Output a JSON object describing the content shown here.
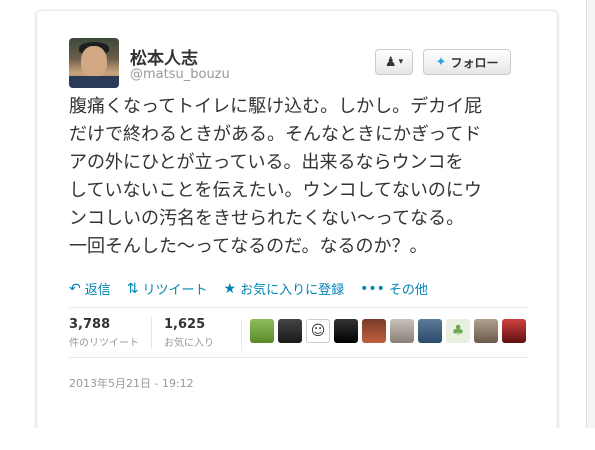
{
  "profile": {
    "name": "松本人志",
    "handle": "@matsu_bouzu"
  },
  "buttons": {
    "user_menu_label": "▾",
    "follow_label": "フォロー"
  },
  "tweet_lines": [
    "腹痛くなってトイレに駆け込む。しかし。デカイ屁",
    "だけで終わるときがある。そんなときにかぎってド",
    "アの外にひとが立っている。出来るならウンコを",
    "していないことを伝えたい。ウンコしてないのにウ",
    "ンコしいの汚名をきせられたくない〜ってなる。",
    "一回そんした〜ってなるのだ。なるのか？。"
  ],
  "actions": {
    "reply": "返信",
    "retweet": "リツイート",
    "favorite": "お気に入りに登録",
    "more": "その他"
  },
  "stats": {
    "retweets_count": "3,788",
    "retweets_label": "件のリツイート",
    "favorites_count": "1,625",
    "favorites_label": "お気に入り"
  },
  "timestamp": "2013年5月21日 - 19:12",
  "colors": {
    "link": "#0084b4",
    "bird": "#2ba3e3"
  },
  "favoriters_icons": [
    "avatar-landscape-icon",
    "avatar-person-icon",
    "avatar-face-cartoon-icon",
    "avatar-dark-figure-icon",
    "avatar-group-icon",
    "avatar-person2-icon",
    "avatar-doll-icon",
    "avatar-clover-icon",
    "avatar-person3-icon",
    "avatar-red-icon"
  ]
}
